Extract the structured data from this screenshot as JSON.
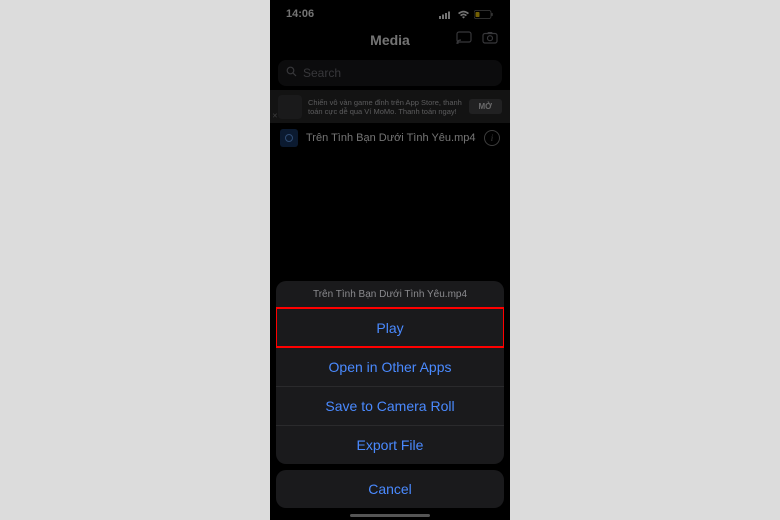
{
  "status": {
    "time": "14:06"
  },
  "nav": {
    "title": "Media"
  },
  "search": {
    "placeholder": "Search"
  },
  "ad": {
    "text": "Chiến vô vàn game đỉnh trên App Store, thanh toán cực dễ qua Ví MoMo. Thanh toán ngay!",
    "button": "MỞ"
  },
  "file": {
    "name": "Trên Tình Bạn Dưới Tình Yêu.mp4"
  },
  "sheet": {
    "title": "Trên Tình Bạn Dưới Tình Yêu.mp4",
    "play": "Play",
    "open_other": "Open in Other Apps",
    "save_camera": "Save to Camera Roll",
    "export": "Export File",
    "cancel": "Cancel"
  }
}
